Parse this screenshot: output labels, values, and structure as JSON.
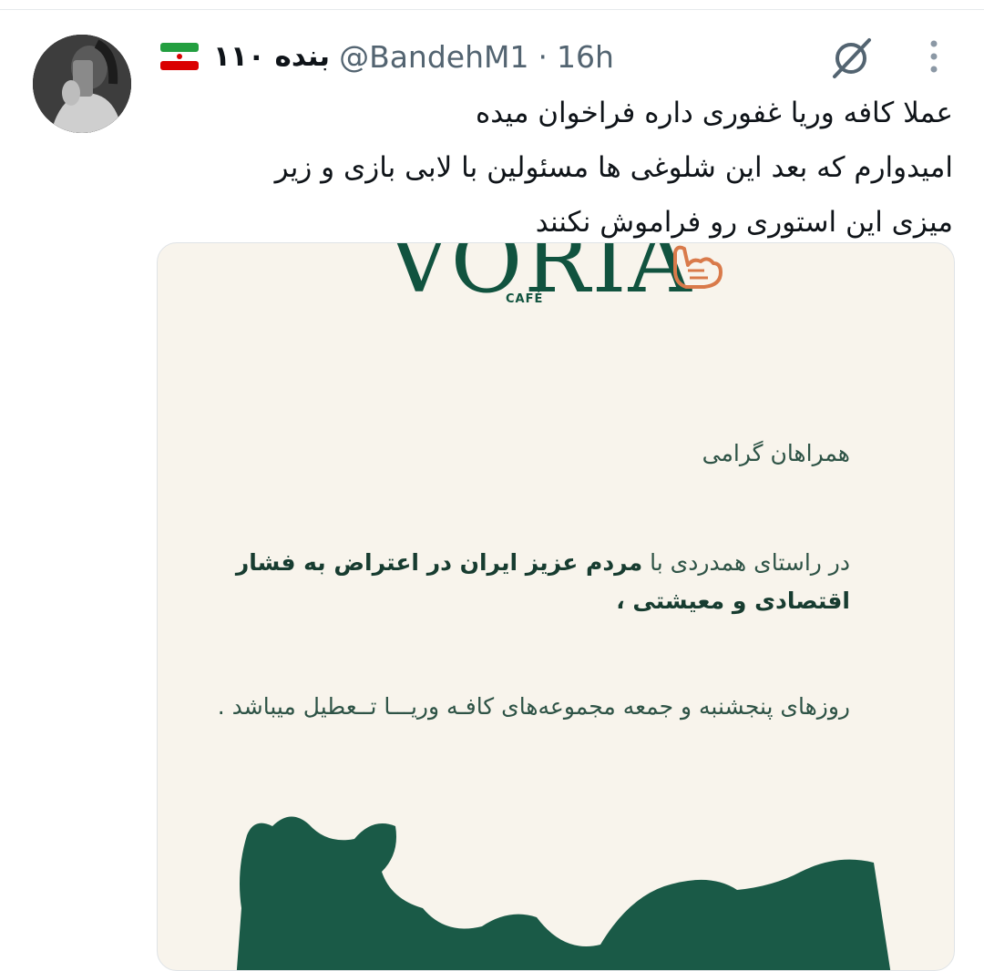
{
  "author": {
    "display_name": "بنده ۱۱۰",
    "flag": "🇮🇷",
    "handle": "@BandehM1",
    "separator": "·",
    "time": "16h"
  },
  "icons": {
    "grok": "slashed-circle-icon",
    "more": "more-vertical-icon"
  },
  "tweet": {
    "lines": [
      "عملا کافه وریا غفوری داره فراخوان میده",
      "امیدوارم که بعد این شلوغی ها مسئولین با لابی بازی و زیر",
      "میزی این استوری رو فراموش نکنند"
    ]
  },
  "media": {
    "logo_text": "VORIA",
    "logo_sub": "CAFÉ",
    "greeting": "همراهان گرامی",
    "para1_prefix": "در راستای همدردی با ",
    "para1_bold": "مردم عزیز ایران در اعتراض به فشار اقتصادی و معیشتی ،",
    "para2": "روزهای پنجشنبه و جمعه مجموعه‌های کافـه وریـــا تــعطیل میباشد .",
    "colors": {
      "brand_green": "#11533f",
      "background": "#f8f4ec",
      "hand_accent": "#d97a4a"
    }
  }
}
